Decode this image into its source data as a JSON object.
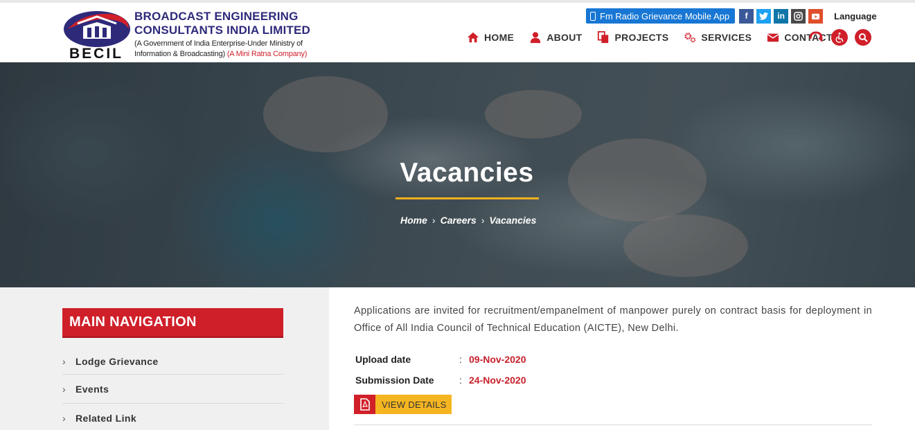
{
  "brand": {
    "title_line1": "BROADCAST ENGINEERING",
    "title_line2": "CONSULTANTS INDIA LIMITED",
    "sub_line1": "(A Government of India Enterprise-Under Ministry of",
    "sub_line2": "Information & Broadcasting)",
    "sub_tag": "(A Mini Ratna Company)",
    "short": "BECIL"
  },
  "topbar": {
    "app_button": "Fm Radio Grievance Mobile App",
    "social": [
      {
        "icon": "facebook-icon",
        "glyph": "f"
      },
      {
        "icon": "twitter-icon",
        "glyph": "t"
      },
      {
        "icon": "linkedin-icon",
        "glyph": "in"
      },
      {
        "icon": "instagram-icon",
        "glyph": "◘"
      },
      {
        "icon": "youtube-icon",
        "glyph": "▶"
      }
    ],
    "language_label": "Language"
  },
  "nav": {
    "items": [
      {
        "label": "HOME",
        "icon": "home-icon"
      },
      {
        "label": "ABOUT",
        "icon": "user-icon"
      },
      {
        "label": "PROJECTS",
        "icon": "documents-icon"
      },
      {
        "label": "SERVICES",
        "icon": "gears-icon"
      },
      {
        "label": "CONTACT",
        "icon": "envelope-icon"
      }
    ],
    "utility_icons": [
      "audio-icon",
      "accessibility-icon",
      "search-icon"
    ]
  },
  "hero": {
    "title": "Vacancies",
    "breadcrumb": [
      "Home",
      "Careers",
      "Vacancies"
    ]
  },
  "sidebar": {
    "heading": "MAIN NAVIGATION",
    "items": [
      "Lodge Grievance",
      "Events",
      "Related Link"
    ]
  },
  "vacancy": {
    "description": "Applications are invited for recruitment/empanelment of manpower purely on contract basis for deployment in Office of All India Council of Technical Education (AICTE), New Delhi.",
    "upload_label": "Upload date",
    "upload_value": "09-Nov-2020",
    "submission_label": "Submission Date",
    "submission_value": "24-Nov-2020",
    "separator": ":",
    "view_button": "VIEW DETAILS"
  },
  "colors": {
    "brand_red": "#d01f29",
    "brand_navy": "#2e2a7a",
    "accent_yellow": "#f5b521",
    "app_blue": "#1877d4"
  }
}
